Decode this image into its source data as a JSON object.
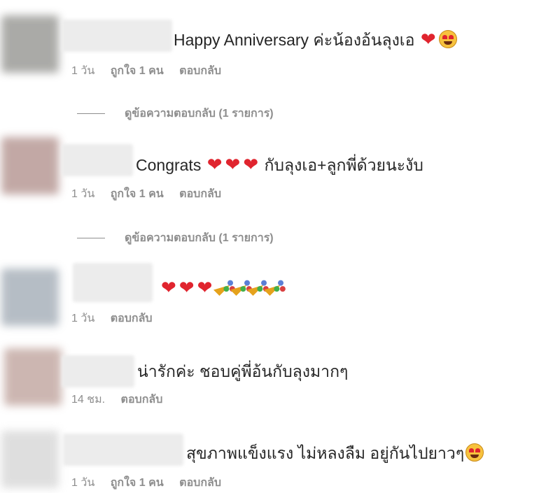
{
  "comments": [
    {
      "text": "Happy Anniversary ค่ะน้องอ้นลุงเอ",
      "time": "1 วัน",
      "likes": "ถูกใจ 1 คน",
      "reply": "ตอบกลับ",
      "view_replies": "ดูข้อความตอบกลับ (1 รายการ)"
    },
    {
      "text_prefix": "Congrats",
      "text": "กับลุงเอ+ลูกพี่ด้วยนะงับ",
      "time": "1 วัน",
      "likes": "ถูกใจ 1 คน",
      "reply": "ตอบกลับ",
      "view_replies": "ดูข้อความตอบกลับ (1 รายการ)"
    },
    {
      "time": "1 วัน",
      "reply": "ตอบกลับ"
    },
    {
      "text": "น่ารักค่ะ ชอบคู่พี่อ้นกับลุงมากๆ",
      "time": "14 ชม.",
      "reply": "ตอบกลับ"
    },
    {
      "text": "สุขภาพแข็งแรง ไม่หลงลืม อยู่กันไปยาวๆ",
      "time": "1 วัน",
      "likes": "ถูกใจ 1 คน",
      "reply": "ตอบกลับ"
    }
  ],
  "icons": {
    "heart": "heart-emoji",
    "heart_eyes": "heart-eyes-emoji",
    "party": "party-popper-emoji"
  },
  "colors": {
    "text": "#262626",
    "meta": "#8e8e8e",
    "heart": "#e0242e"
  }
}
